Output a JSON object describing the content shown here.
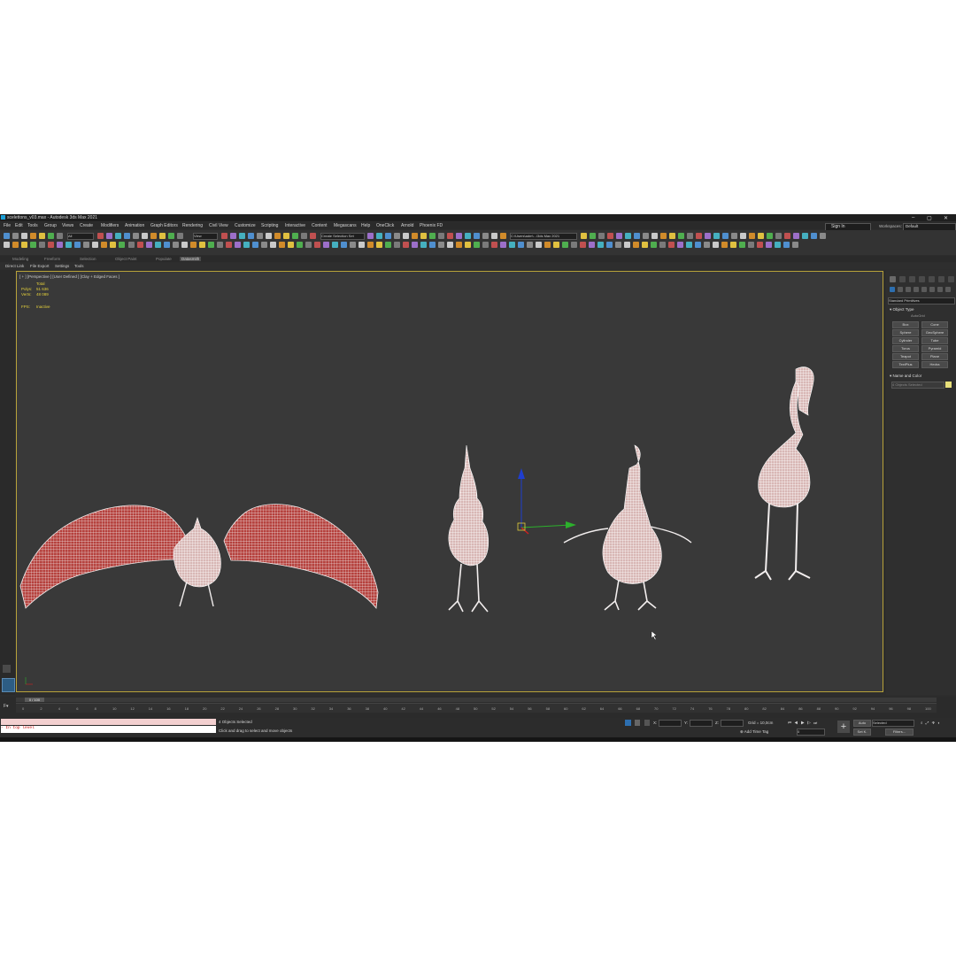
{
  "window": {
    "title": "scelettons_v03.max - Autodesk 3ds Max 2021",
    "minimize": "–",
    "maximize": "▢",
    "close": "✕"
  },
  "menu": [
    "File",
    "Edit",
    "Tools",
    "Group",
    "Views",
    "Create",
    "Modifiers",
    "Animation",
    "Graph Editors",
    "Rendering",
    "Civil View",
    "Customize",
    "Scripting",
    "Interactive",
    "Content",
    "Megascans",
    "Help",
    "OneClick",
    "Arnold",
    "Phoenix FD"
  ],
  "account": {
    "signin": "Sign In",
    "workspaces_label": "Workspaces:",
    "workspace": "Default"
  },
  "toolbar": {
    "filter": "All",
    "view": "View",
    "selection_set": "Create Selection Set",
    "project_path": "C:\\Users\\adm\\...\\3ds Max 2021"
  },
  "ribbon": {
    "tabs": [
      "Modeling",
      "Freeform",
      "Selection",
      "Object Paint",
      "Populate",
      "Datasmith"
    ],
    "active": "Datasmith",
    "links": [
      "Direct Link",
      "File Export",
      "Settings",
      "Tools"
    ]
  },
  "viewport": {
    "label": "[ + ] [Perspective ] [User Defined ] [Clay + Edged Faces ]",
    "stats": {
      "total_label": "Total",
      "polys_label": "Polys:",
      "polys_value": "51 636",
      "verts_label": "Verts:",
      "verts_value": "48 089",
      "fps_label": "FPS:",
      "fps_value": "Inactive"
    }
  },
  "command_panel": {
    "category": "Standard Primitives",
    "object_type_header": "Object Type",
    "autogrid": "AutoGrid",
    "buttons": [
      "Box",
      "Cone",
      "Sphere",
      "GeoSphere",
      "Cylinder",
      "Tube",
      "Torus",
      "Pyramid",
      "Teapot",
      "Plane",
      "TextPlus",
      "Hedra"
    ],
    "name_color_header": "Name and Color",
    "name_field": "4 Objects Selected",
    "swatch_color": "#e8e07a"
  },
  "timeline": {
    "frame_display": "0 / 100",
    "ticks": [
      "0",
      "2",
      "4",
      "6",
      "8",
      "10",
      "12",
      "14",
      "16",
      "18",
      "20",
      "22",
      "24",
      "26",
      "28",
      "30",
      "32",
      "34",
      "36",
      "38",
      "40",
      "42",
      "44",
      "46",
      "48",
      "50",
      "52",
      "54",
      "56",
      "58",
      "60",
      "62",
      "64",
      "66",
      "68",
      "70",
      "72",
      "74",
      "76",
      "78",
      "80",
      "82",
      "84",
      "86",
      "88",
      "90",
      "92",
      "94",
      "96",
      "98",
      "100"
    ]
  },
  "status": {
    "maxscript": "- In top level",
    "selected": "4 Objects Selected",
    "prompt": "Click and drag to select and move objects",
    "x_label": "X:",
    "y_label": "Y:",
    "z_label": "Z:",
    "grid": "Grid = 10,0cm",
    "add_time_tag": "Add Time Tag",
    "auto": "Auto",
    "set_k": "Set K.",
    "selected_dropdown": "Selected",
    "filters": "Filters...",
    "frame": "0"
  },
  "colors": {
    "viewport_bg": "#393939",
    "wire": "#f2eeee",
    "flesh": "#b5403c",
    "stat_text": "#e3cf3b",
    "active_border": "#b7a23a"
  }
}
